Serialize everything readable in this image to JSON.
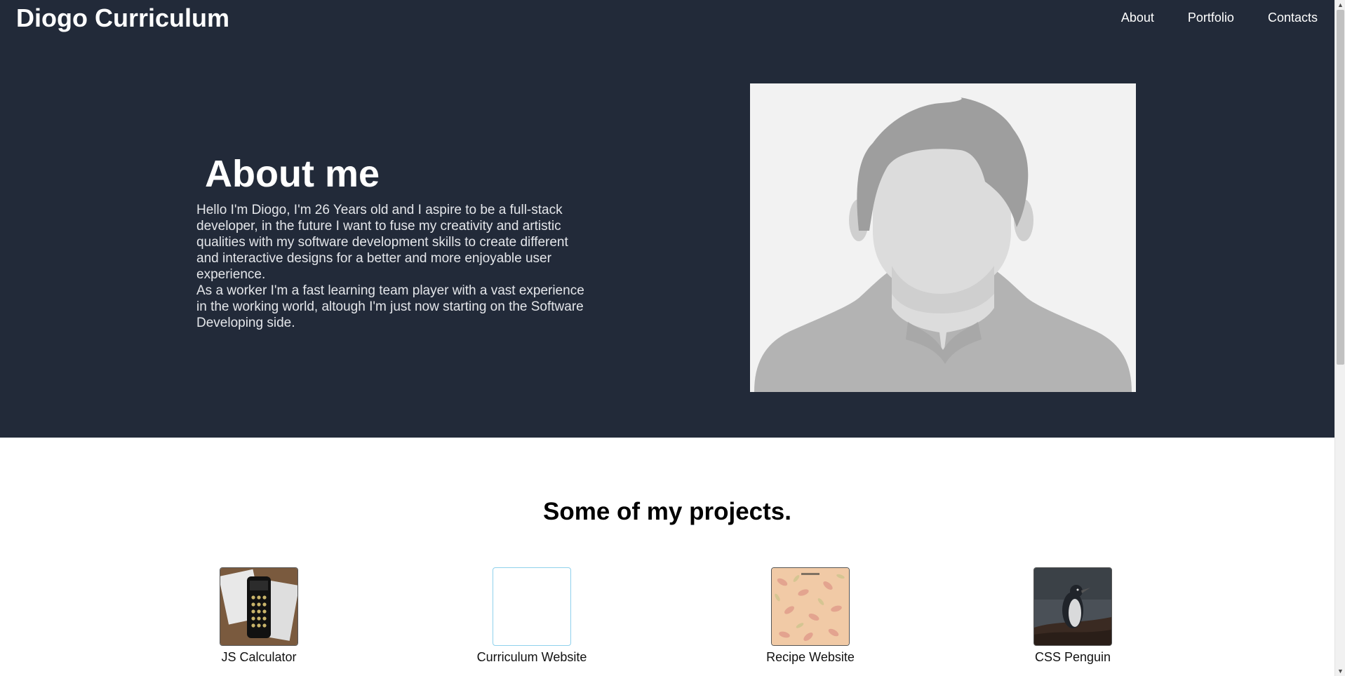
{
  "header": {
    "title": "Diogo Curriculum",
    "nav": [
      "About",
      "Portfolio",
      "Contacts"
    ]
  },
  "about": {
    "title": "About me",
    "paragraph": "Hello I'm Diogo, I'm 26 Years old and I aspire to be a full-stack developer, in the future I want to fuse my creativity and artistic qualities with my software development skills to create different and interactive designs for a better and more enjoyable user experience.\nAs a worker I'm a fast learning team player with a vast experience in the working world, altough I'm just now starting on the Software Developing side."
  },
  "projects": {
    "title": "Some of my projects.",
    "items": [
      {
        "label": "JS Calculator",
        "icon": "calculator-photo"
      },
      {
        "label": "Curriculum Website",
        "icon": "blank-thumbnail"
      },
      {
        "label": "Recipe Website",
        "icon": "recipe-pattern"
      },
      {
        "label": "CSS Penguin",
        "icon": "penguin-photo"
      }
    ]
  },
  "colors": {
    "header_bg": "#222a39",
    "text_light": "#ffffff"
  }
}
